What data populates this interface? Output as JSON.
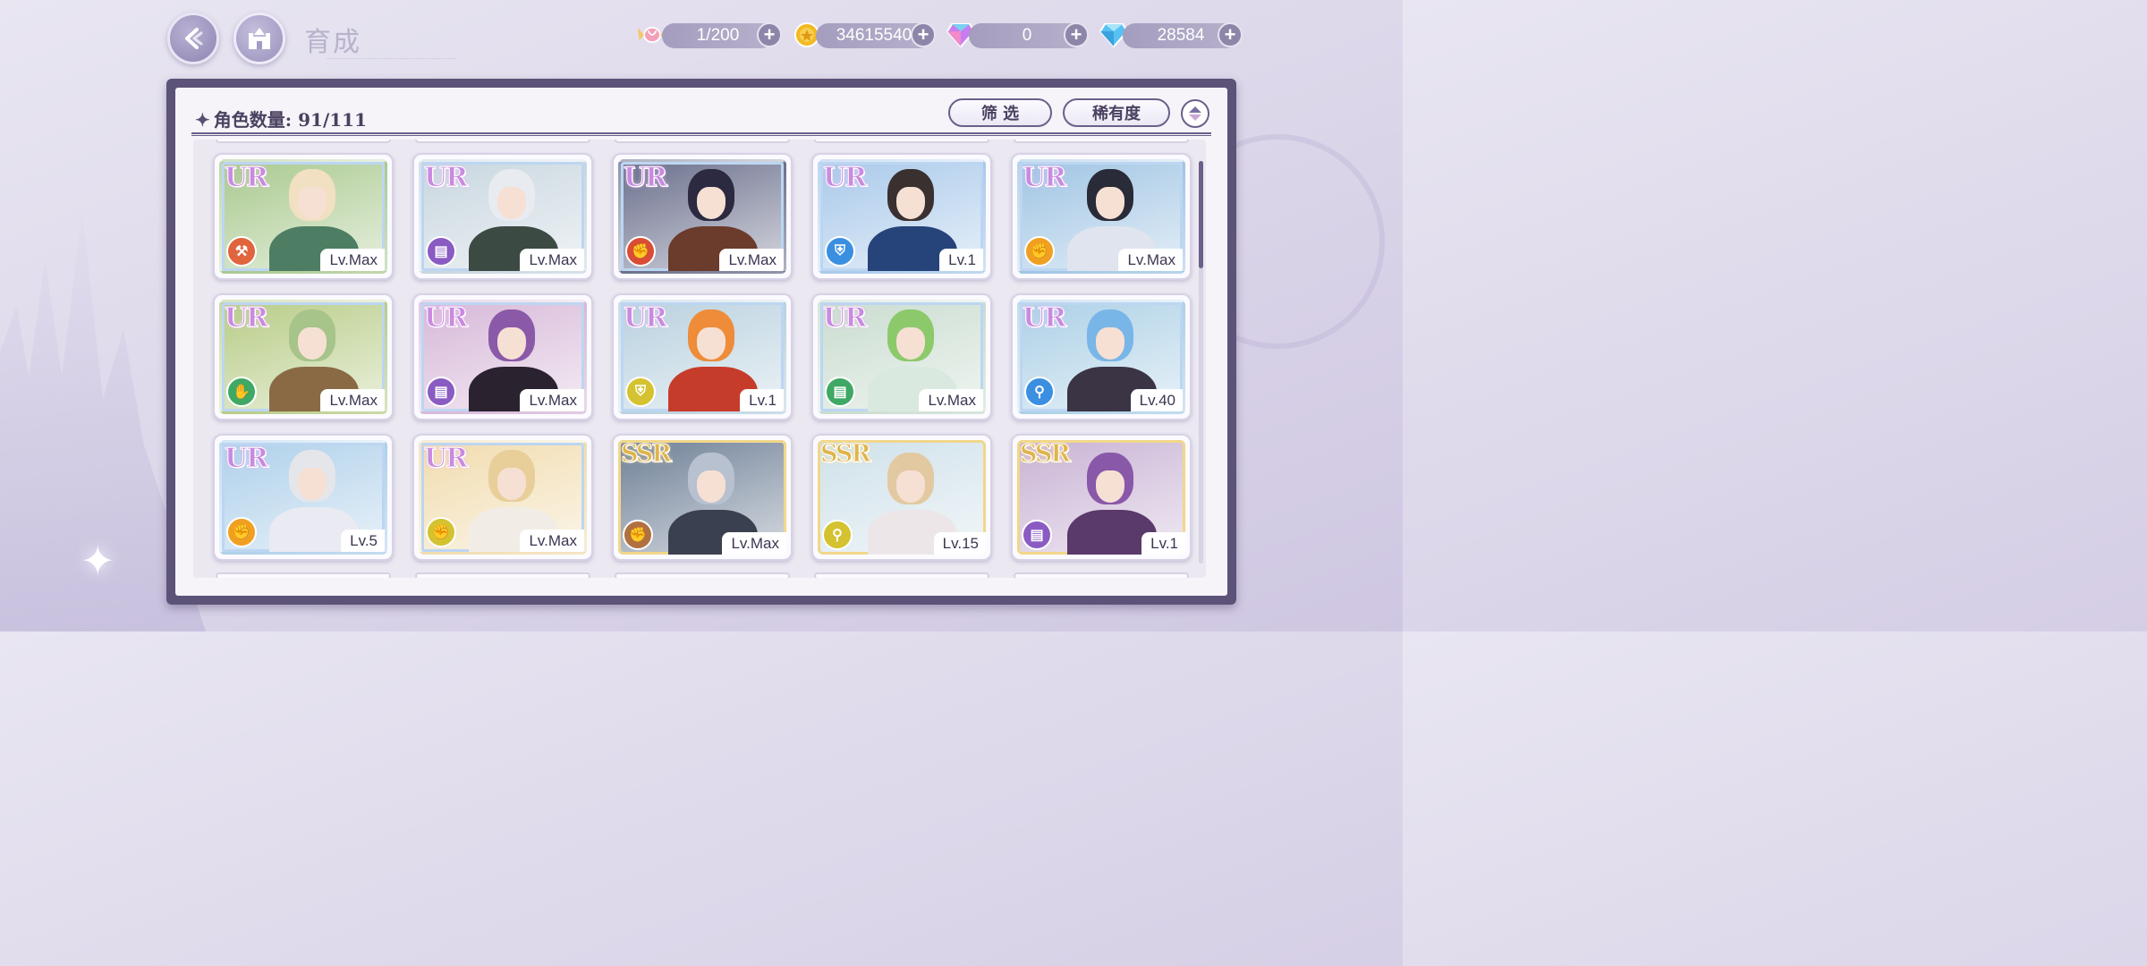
{
  "header": {
    "title": "育成",
    "back_icon": "back-arrow-icon",
    "home_icon": "castle-home-icon"
  },
  "resources": [
    {
      "name": "candy",
      "icon": "candy-icon",
      "value": "1/200",
      "color": "#f08aa8"
    },
    {
      "name": "gold",
      "icon": "gold-coin-icon",
      "value": "34615540",
      "color": "#f3b922"
    },
    {
      "name": "rainbow_gem",
      "icon": "rainbow-diamond-icon",
      "value": "0",
      "color": "#c77cf0"
    },
    {
      "name": "diamond",
      "icon": "diamond-icon",
      "value": "28584",
      "color": "#58c1f2"
    }
  ],
  "panel": {
    "count_label": "角色数量: 91/111",
    "filter_label": "筛 选",
    "rarity_sort_label": "稀有度"
  },
  "attr_colors": {
    "fire": "#e0643c",
    "purple": "#8a5bc2",
    "red": "#d94c35",
    "blue": "#3a8fe0",
    "orange": "#f0a020",
    "green": "#3fa864",
    "yellow": "#d4c230",
    "brown": "#b07040"
  },
  "cards": [
    {
      "rarity": "UR",
      "level": "Lv.Max",
      "attr": "fire",
      "attr_icon": "hammer-icon",
      "hair": "#f1e0c2",
      "outfit": "#4d7d62",
      "bg": "#a9c98e"
    },
    {
      "rarity": "UR",
      "level": "Lv.Max",
      "attr": "purple",
      "attr_icon": "book-icon",
      "hair": "#e8ebef",
      "outfit": "#3c4a44",
      "bg": "#c8d6df"
    },
    {
      "rarity": "UR",
      "level": "Lv.Max",
      "attr": "red",
      "attr_icon": "fist-icon",
      "hair": "#2b2a40",
      "outfit": "#6b3b2b",
      "bg": "#6a6f8c"
    },
    {
      "rarity": "UR",
      "level": "Lv.1",
      "attr": "blue",
      "attr_icon": "shield-icon",
      "hair": "#3a3030",
      "outfit": "#26437a",
      "bg": "#a9c9ea"
    },
    {
      "rarity": "UR",
      "level": "Lv.Max",
      "attr": "orange",
      "attr_icon": "fist-icon",
      "hair": "#2a2b38",
      "outfit": "#dfe4ee",
      "bg": "#9fc4e3"
    },
    {
      "rarity": "UR",
      "level": "Lv.Max",
      "attr": "green",
      "attr_icon": "hand-icon",
      "hair": "#a7c48a",
      "outfit": "#8a6a45",
      "bg": "#b7cc86"
    },
    {
      "rarity": "UR",
      "level": "Lv.Max",
      "attr": "purple",
      "attr_icon": "book-icon",
      "hair": "#8a5aa8",
      "outfit": "#2b2230",
      "bg": "#d7b8d8"
    },
    {
      "rarity": "UR",
      "level": "Lv.1",
      "attr": "yellow",
      "attr_icon": "shield-icon",
      "hair": "#ee8c3a",
      "outfit": "#c63c2a",
      "bg": "#b9d1df"
    },
    {
      "rarity": "UR",
      "level": "Lv.Max",
      "attr": "green",
      "attr_icon": "book-icon",
      "hair": "#8cc96a",
      "outfit": "#d9e9df",
      "bg": "#c9dccf"
    },
    {
      "rarity": "UR",
      "level": "Lv.40",
      "attr": "blue",
      "attr_icon": "wand-icon",
      "hair": "#79b6e8",
      "outfit": "#3a3445",
      "bg": "#acd0e6"
    },
    {
      "rarity": "UR",
      "level": "Lv.5",
      "attr": "orange",
      "attr_icon": "fist-icon",
      "hair": "#e4e6ea",
      "outfit": "#e9eaf2",
      "bg": "#aed0ea"
    },
    {
      "rarity": "UR",
      "level": "Lv.Max",
      "attr": "yellow",
      "attr_icon": "fist-icon",
      "hair": "#e8cf9a",
      "outfit": "#f1ede6",
      "bg": "#f1dcae"
    },
    {
      "rarity": "SSR",
      "level": "Lv.Max",
      "attr": "brown",
      "attr_icon": "fist-icon",
      "hair": "#b7c1cf",
      "outfit": "#3b4050",
      "bg": "#6e7f96"
    },
    {
      "rarity": "SSR",
      "level": "Lv.15",
      "attr": "yellow",
      "attr_icon": "wand-icon",
      "hair": "#e2c9a2",
      "outfit": "#ece6e8",
      "bg": "#cfe1ea"
    },
    {
      "rarity": "SSR",
      "level": "Lv.1",
      "attr": "purple",
      "attr_icon": "book-icon",
      "hair": "#8a58a8",
      "outfit": "#5a3a6a",
      "bg": "#c8b2d4"
    }
  ]
}
